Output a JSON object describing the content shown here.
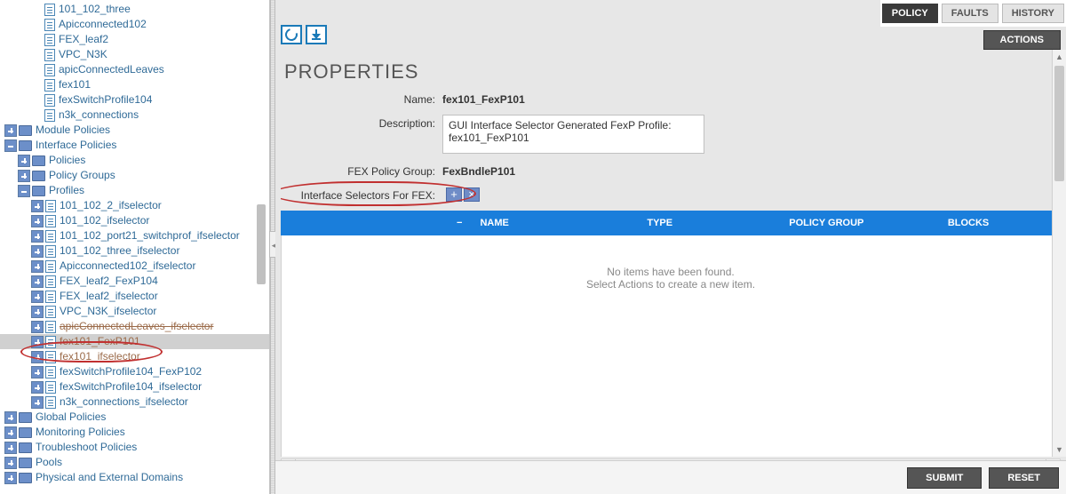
{
  "tree": {
    "top_items": [
      {
        "label": "101_102_three",
        "kind": "doc",
        "indent": 50
      },
      {
        "label": "Apicconnected102",
        "kind": "doc",
        "indent": 50
      },
      {
        "label": "FEX_leaf2",
        "kind": "doc",
        "indent": 50
      },
      {
        "label": "VPC_N3K",
        "kind": "doc",
        "indent": 50
      },
      {
        "label": "apicConnectedLeaves",
        "kind": "doc",
        "indent": 50
      },
      {
        "label": "fex101",
        "kind": "doc",
        "indent": 50
      },
      {
        "label": "fexSwitchProfile104",
        "kind": "doc",
        "indent": 50
      },
      {
        "label": "n3k_connections",
        "kind": "doc",
        "indent": 50
      }
    ],
    "modules": {
      "label": "Module Policies",
      "toggle": "expand",
      "indent": 5
    },
    "interface": {
      "label": "Interface Policies",
      "toggle": "collapse",
      "indent": 5
    },
    "policies": {
      "label": "Policies",
      "toggle": "expand",
      "indent": 20
    },
    "policy_groups": {
      "label": "Policy Groups",
      "toggle": "expand",
      "indent": 20
    },
    "profiles": {
      "label": "Profiles",
      "toggle": "collapse",
      "indent": 20
    },
    "profile_items": [
      {
        "label": "101_102_2_ifselector",
        "toggle": "expand",
        "kind": "doc",
        "indent": 35
      },
      {
        "label": "101_102_ifselector",
        "toggle": "expand",
        "kind": "doc",
        "indent": 35
      },
      {
        "label": "101_102_port21_switchprof_ifselector",
        "toggle": "expand",
        "kind": "doc",
        "indent": 35
      },
      {
        "label": "101_102_three_ifselector",
        "toggle": "expand",
        "kind": "doc",
        "indent": 35
      },
      {
        "label": "Apicconnected102_ifselector",
        "toggle": "expand",
        "kind": "doc",
        "indent": 35
      },
      {
        "label": "FEX_leaf2_FexP104",
        "toggle": "expand",
        "kind": "doc",
        "indent": 35
      },
      {
        "label": "FEX_leaf2_ifselector",
        "toggle": "expand",
        "kind": "doc",
        "indent": 35
      },
      {
        "label": "VPC_N3K_ifselector",
        "toggle": "expand",
        "kind": "doc",
        "indent": 35
      },
      {
        "label": "apicConnectedLeaves_ifselector",
        "toggle": "expand",
        "kind": "doc",
        "indent": 35,
        "style": "brown"
      },
      {
        "label": "fex101_FexP101",
        "toggle": "expand",
        "kind": "doc",
        "indent": 35,
        "selected": true,
        "style": "brown2"
      },
      {
        "label": "fex101_ifselector",
        "toggle": "expand",
        "kind": "doc",
        "indent": 35,
        "style": "brown2"
      },
      {
        "label": "fexSwitchProfile104_FexP102",
        "toggle": "expand",
        "kind": "doc",
        "indent": 35
      },
      {
        "label": "fexSwitchProfile104_ifselector",
        "toggle": "expand",
        "kind": "doc",
        "indent": 35
      },
      {
        "label": "n3k_connections_ifselector",
        "toggle": "expand",
        "kind": "doc",
        "indent": 35
      }
    ],
    "bottom": [
      {
        "label": "Global Policies",
        "toggle": "expand",
        "indent": 5
      },
      {
        "label": "Monitoring Policies",
        "toggle": "expand",
        "indent": 5
      },
      {
        "label": "Troubleshoot Policies",
        "toggle": "expand",
        "indent": 5
      },
      {
        "label": "Pools",
        "toggle": "expand",
        "indent": 5
      },
      {
        "label": "Physical and External Domains",
        "toggle": "expand",
        "indent": 5
      }
    ]
  },
  "tabs": {
    "policy": "POLICY",
    "faults": "FAULTS",
    "history": "HISTORY"
  },
  "actions_label": "ACTIONS",
  "panel_title": "PROPERTIES",
  "form": {
    "name_label": "Name:",
    "name_value": "fex101_FexP101",
    "desc_label": "Description:",
    "desc_value": "GUI Interface Selector Generated FexP Profile:\nfex101_FexP101",
    "group_label": "FEX Policy Group:",
    "group_value": "FexBndleP101",
    "sel_label": "Interface Selectors For FEX:"
  },
  "grid": {
    "minus": "−",
    "cols": {
      "c1": "NAME",
      "c2": "TYPE",
      "c3": "POLICY GROUP",
      "c4": "BLOCKS"
    },
    "empty1": "No items have been found.",
    "empty2": "Select Actions to create a new item."
  },
  "footer": {
    "submit": "SUBMIT",
    "reset": "RESET"
  }
}
